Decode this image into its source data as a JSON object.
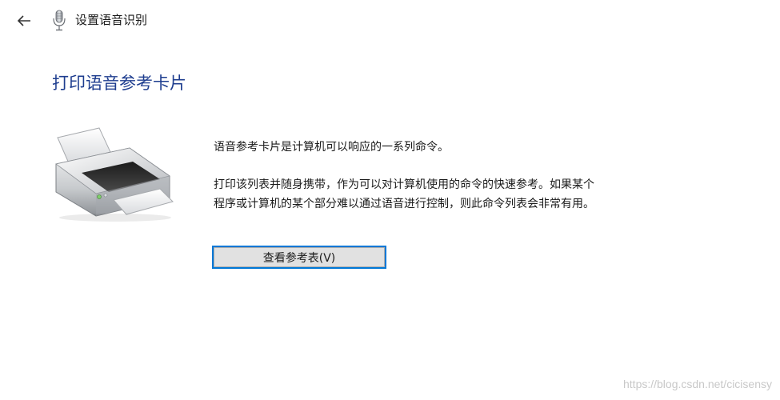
{
  "header": {
    "back_icon": "back-arrow-icon",
    "app_icon": "microphone-icon",
    "title": "设置语音识别"
  },
  "main": {
    "heading": "打印语音参考卡片",
    "illustration": "printer-icon",
    "paragraph1": "语音参考卡片是计算机可以响应的一系列命令。",
    "paragraph2_line1": "打印该列表并随身携带，作为可以对计算机使用的命令的快速参考。如果某个",
    "paragraph2_line2": "程序或计算机的某个部分难以通过语音进行控制，则此命令列表会非常有用。",
    "view_button_label": "查看参考表(V)"
  },
  "colors": {
    "heading": "#1e3d8f",
    "button_focus_border": "#0078d7",
    "button_bg": "#e1e1e1"
  },
  "watermark": "https://blog.csdn.net/cicisensy"
}
